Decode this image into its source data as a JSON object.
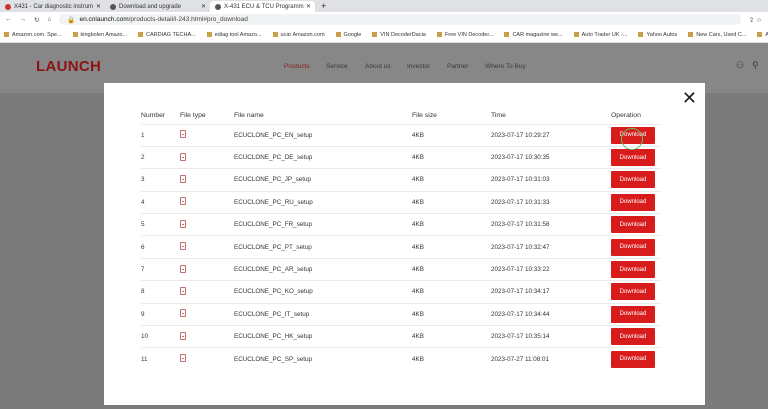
{
  "browser": {
    "tabs": [
      {
        "label": "X431 - Car diagnostic instrum"
      },
      {
        "label": "Download and upgrade"
      },
      {
        "label": "X-431 ECU & TCU Programm"
      }
    ],
    "url_host": "en.cnlaunch.com",
    "url_path": "/products-detail/i-243.html#pro_download",
    "bookmarks": [
      "Amazon.com. Spe...",
      "kingbolen Amazo...",
      "CARDIAG TECHA...",
      "ediag tool Amazo...",
      "ucar Amazon.com",
      "Google",
      "VIN DecoderDacia",
      "Free VIN Decoder...",
      "CAR magazine we...",
      "Auto Trader UK -...",
      "Yahoo Autos",
      "New Cars, Used C...",
      "Autoblog: C"
    ]
  },
  "site": {
    "logo": "LAUNCH",
    "nav": [
      "Products",
      "Service",
      "About us",
      "Investor",
      "Partner",
      "Where To Buy"
    ],
    "accent": "#d81c1c"
  },
  "modal": {
    "close": "✕",
    "columns": [
      "Number",
      "File type",
      "File name",
      "File size",
      "Time",
      "Operation"
    ],
    "rows": [
      {
        "n": "1",
        "name": "ECUCLONE_PC_EN_setup",
        "size": "4KB",
        "time": "2023-07-17 10:29:27",
        "op": "Download"
      },
      {
        "n": "2",
        "name": "ECUCLONE_PC_DE_setup",
        "size": "4KB",
        "time": "2023-07-17 10:30:35",
        "op": "Download"
      },
      {
        "n": "3",
        "name": "ECUCLONE_PC_JP_setup",
        "size": "4KB",
        "time": "2023-07-17 10:31:03",
        "op": "Download"
      },
      {
        "n": "4",
        "name": "ECUCLONE_PC_RU_setup",
        "size": "4KB",
        "time": "2023-07-17 10:31:33",
        "op": "Download"
      },
      {
        "n": "5",
        "name": "ECUCLONE_PC_FR_setup",
        "size": "4KB",
        "time": "2023-07-17 10:31:58",
        "op": "Download"
      },
      {
        "n": "6",
        "name": "ECUCLONE_PC_PT_setup",
        "size": "4KB",
        "time": "2023-07-17 10:32:47",
        "op": "Download"
      },
      {
        "n": "7",
        "name": "ECUCLONE_PC_AR_setup",
        "size": "4KB",
        "time": "2023-07-17 10:33:22",
        "op": "Download"
      },
      {
        "n": "8",
        "name": "ECUCLONE_PC_KO_setup",
        "size": "4KB",
        "time": "2023-07-17 10:34:17",
        "op": "Download"
      },
      {
        "n": "9",
        "name": "ECUCLONE_PC_IT_setup",
        "size": "4KB",
        "time": "2023-07-17 10:34:44",
        "op": "Download"
      },
      {
        "n": "10",
        "name": "ECUCLONE_PC_HK_setup",
        "size": "4KB",
        "time": "2023-07-17 10:35:14",
        "op": "Download"
      },
      {
        "n": "11",
        "name": "ECUCLONE_PC_SP_setup",
        "size": "4KB",
        "time": "2023-07-27 11:08:01",
        "op": "Download"
      }
    ]
  }
}
